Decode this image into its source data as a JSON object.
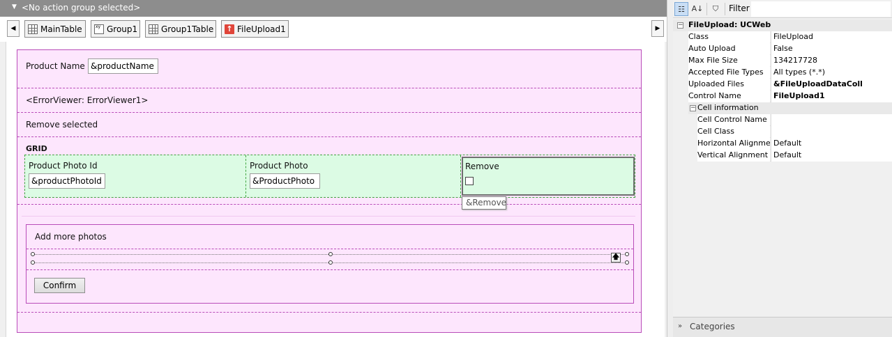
{
  "action_group": {
    "label": "<No action group selected>"
  },
  "tabs": [
    {
      "label": "MainTable",
      "icon": "grid-icon"
    },
    {
      "label": "Group1",
      "icon": "group-icon"
    },
    {
      "label": "Group1Table",
      "icon": "grid-icon"
    },
    {
      "label": "FileUpload1",
      "icon": "upload-icon"
    }
  ],
  "form": {
    "product_name_label": "Product Name",
    "product_name_value": "&productName",
    "error_viewer": "<ErrorViewer: ErrorViewer1>",
    "remove_selected": "Remove selected",
    "grid": {
      "title": "GRID",
      "columns": [
        {
          "header": "Product Photo Id",
          "value": "&productPhotoId"
        },
        {
          "header": "Product Photo",
          "value": "&ProductPhoto"
        },
        {
          "header": "Remove",
          "value": ""
        }
      ],
      "tooltip": "&Remove"
    },
    "add_more_label": "Add more photos",
    "confirm_label": "Confirm"
  },
  "properties": {
    "filter_label": "Filter",
    "header": "FileUpload: UCWeb",
    "rows": [
      {
        "name": "Class",
        "value": "FileUpload",
        "bold": false
      },
      {
        "name": "Auto Upload",
        "value": "False",
        "bold": false
      },
      {
        "name": "Max File Size",
        "value": "134217728",
        "bold": false
      },
      {
        "name": "Accepted File Types",
        "value": "All types (*.*)",
        "bold": false
      },
      {
        "name": "Uploaded Files",
        "value": "&FileUploadDataColl",
        "bold": true
      },
      {
        "name": "Control Name",
        "value": "FileUpload1",
        "bold": true
      }
    ],
    "cell_info": {
      "label": "Cell information",
      "rows": [
        {
          "name": "Cell Control Name",
          "value": ""
        },
        {
          "name": "Cell Class",
          "value": ""
        },
        {
          "name": "Horizontal Alignment",
          "value": "Default"
        },
        {
          "name": "Vertical Alignment",
          "value": "Default"
        }
      ]
    },
    "categories_label": "Categories"
  }
}
